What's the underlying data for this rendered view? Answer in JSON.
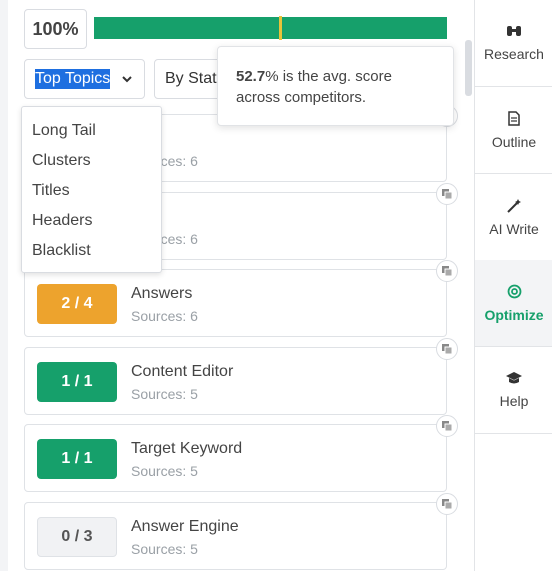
{
  "score": {
    "value": "100%"
  },
  "progress": {
    "fill_percent": 100,
    "marker_percent": 52.7,
    "fill_color": "#16a06b",
    "marker_color": "#e8c33a"
  },
  "filters": {
    "topics_selected": "Top Topics",
    "status_selected": "By Status",
    "topics_options": [
      "Long Tail",
      "Clusters",
      "Titles",
      "Headers",
      "Blacklist"
    ]
  },
  "tooltip": {
    "value": "52.7",
    "text": "% is the avg. score across competitors."
  },
  "cards": [
    {
      "badge": "",
      "title": "c",
      "sources": "Sources: 6",
      "badge_color": "none"
    },
    {
      "badge": "",
      "title": "rs",
      "sources": "Sources: 6",
      "badge_color": "none"
    },
    {
      "badge": "2 / 4",
      "title": "Answers",
      "sources": "Sources: 6",
      "badge_color": "orange"
    },
    {
      "badge": "1 / 1",
      "title": "Content Editor",
      "sources": "Sources: 5",
      "badge_color": "green"
    },
    {
      "badge": "1 / 1",
      "title": "Target Keyword",
      "sources": "Sources: 5",
      "badge_color": "green"
    },
    {
      "badge": "0 / 3",
      "title": "Answer Engine",
      "sources": "Sources: 5",
      "badge_color": "gray"
    }
  ],
  "rail": [
    {
      "label": "Research",
      "icon": "binoculars-icon"
    },
    {
      "label": "Outline",
      "icon": "document-icon"
    },
    {
      "label": "AI Write",
      "icon": "magic-wand-icon"
    },
    {
      "label": "Optimize",
      "icon": "target-icon",
      "active": true
    },
    {
      "label": "Help",
      "icon": "graduation-cap-icon"
    }
  ]
}
